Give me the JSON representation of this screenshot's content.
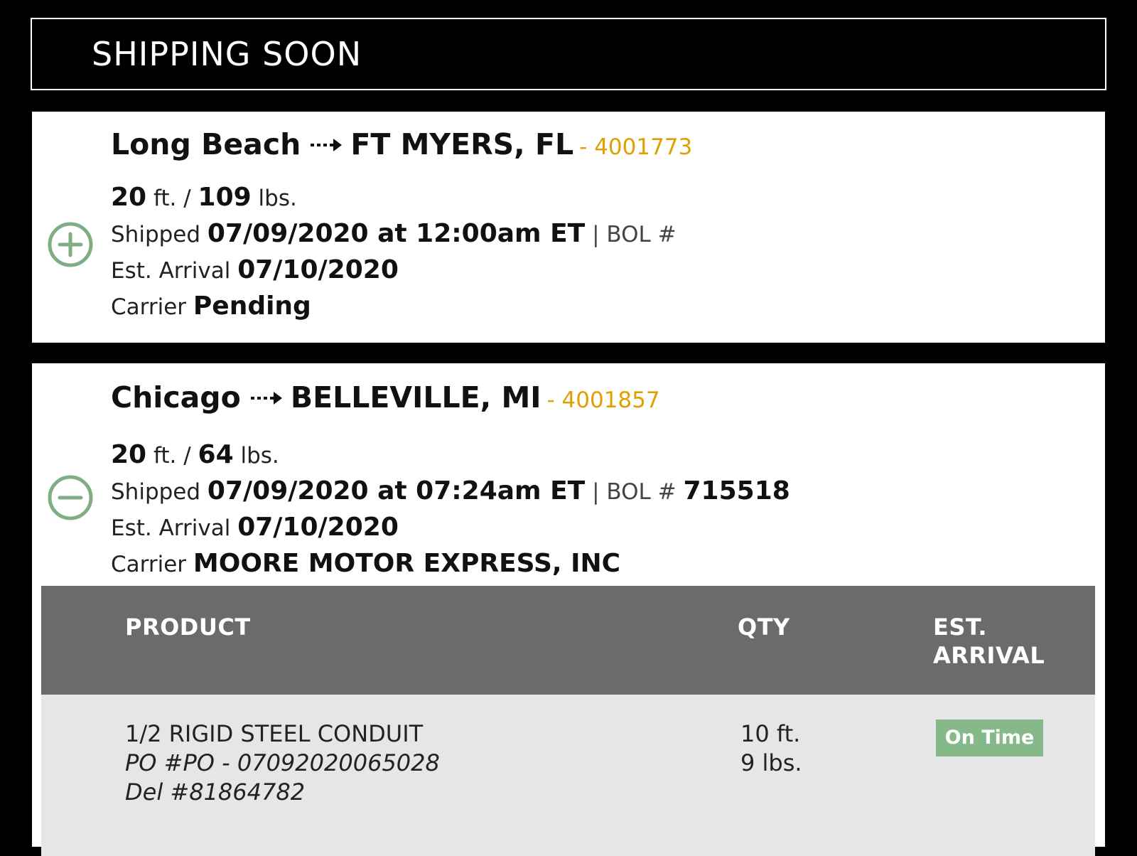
{
  "header": {
    "title": "SHIPPING SOON"
  },
  "colors": {
    "accent_order": "#e0a100",
    "toggle": "#7fae84",
    "status_on_time": "#86b98a",
    "table_header": "#6b6b6d"
  },
  "shipments": [
    {
      "origin": "Long Beach",
      "destination": "FT MYERS, FL",
      "order": "- 4001773",
      "toggle_icon": "plus-circle-icon",
      "length": "20",
      "length_unit": "ft. /",
      "weight": "109",
      "weight_unit": "lbs.",
      "shipped_label": "Shipped",
      "shipped_value": "07/09/2020 at 12:00am ET",
      "bol_label": "| BOL #",
      "bol_value": "",
      "arrival_label": "Est. Arrival",
      "arrival_value": "07/10/2020",
      "carrier_label": "Carrier",
      "carrier_value": "Pending"
    },
    {
      "origin": "Chicago",
      "destination": "BELLEVILLE, MI",
      "order": "- 4001857",
      "toggle_icon": "minus-circle-icon",
      "length": "20",
      "length_unit": "ft. /",
      "weight": "64",
      "weight_unit": "lbs.",
      "shipped_label": "Shipped",
      "shipped_value": "07/09/2020 at 07:24am ET",
      "bol_label": "| BOL #",
      "bol_value": "715518",
      "arrival_label": "Est. Arrival",
      "arrival_value": "07/10/2020",
      "carrier_label": "Carrier",
      "carrier_value": "MOORE MOTOR EXPRESS, INC",
      "table": {
        "headers": {
          "product": "PRODUCT",
          "qty": "QTY",
          "arrival_line1": "EST.",
          "arrival_line2": "ARRIVAL"
        },
        "rows": [
          {
            "product": "1/2 RIGID STEEL CONDUIT",
            "po": "PO #PO - 07092020065028",
            "del": "Del #81864782",
            "qty_length": "10 ft.",
            "qty_weight": "9 lbs.",
            "status": "On Time"
          }
        ]
      }
    }
  ]
}
